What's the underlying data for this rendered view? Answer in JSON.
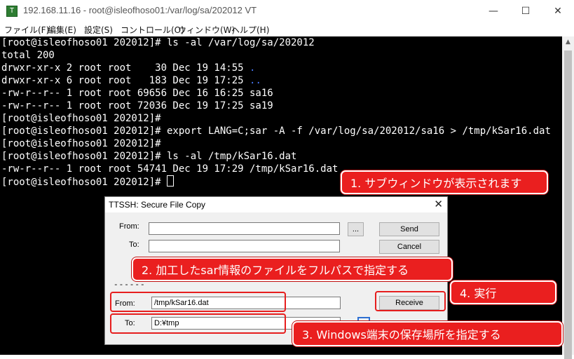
{
  "window": {
    "title": "192.168.11.16 - root@isleofhoso01:/var/log/sa/202012 VT",
    "minimize": "—",
    "maximize": "☐",
    "close": "✕"
  },
  "menu": [
    "ファイル(F)",
    "編集(E)",
    "設定(S)",
    "コントロール(O)",
    "ウィンドウ(W)",
    "ヘルプ(H)"
  ],
  "terminal": {
    "lines": [
      "[root@isleofhoso01 202012]# ls -al /var/log/sa/202012",
      "total 200",
      "drwxr-xr-x 2 root root    30 Dec 19 14:55 ",
      "drwxr-xr-x 6 root root   183 Dec 19 17:25 ",
      "-rw-r--r-- 1 root root 69656 Dec 16 16:25 sa16",
      "-rw-r--r-- 1 root root 72036 Dec 19 17:25 sa19",
      "[root@isleofhoso01 202012]#",
      "[root@isleofhoso01 202012]# export LANG=C;sar -A -f /var/log/sa/202012/sa16 > /tmp/kSar16.dat",
      "[root@isleofhoso01 202012]#",
      "[root@isleofhoso01 202012]# ls -al /tmp/kSar16.dat",
      "-rw-r--r-- 1 root root 54741 Dec 19 17:29 /tmp/kSar16.dat",
      "[root@isleofhoso01 202012]# "
    ],
    "dir_current": ".",
    "dir_parent": ".."
  },
  "dialog": {
    "title": "TTSSH: Secure File Copy",
    "close": "✕",
    "send_from_label": "From:",
    "send_to_label": "To:",
    "send_from_value": "",
    "send_to_value": "",
    "browse_label": "...",
    "send_button": "Send",
    "cancel_button": "Cancel",
    "divider": "------",
    "recv_from_label": "From:",
    "recv_from_value": "/tmp/kSar16.dat",
    "recv_to_label": "To:",
    "recv_to_value": "D:¥tmp",
    "receive_button": "Receive"
  },
  "callouts": {
    "c1": "1. サブウィンドウが表示されます",
    "c2": "2. 加工したsar情報のファイルをフルパスで指定する",
    "c3": "3. Windows端末の保存場所を指定する",
    "c4": "4. 実行"
  },
  "colors": {
    "terminal_bg": "#000000",
    "terminal_fg": "#ffffff",
    "dir_link": "#4a7bff",
    "callout_red": "#ea1f1f"
  }
}
